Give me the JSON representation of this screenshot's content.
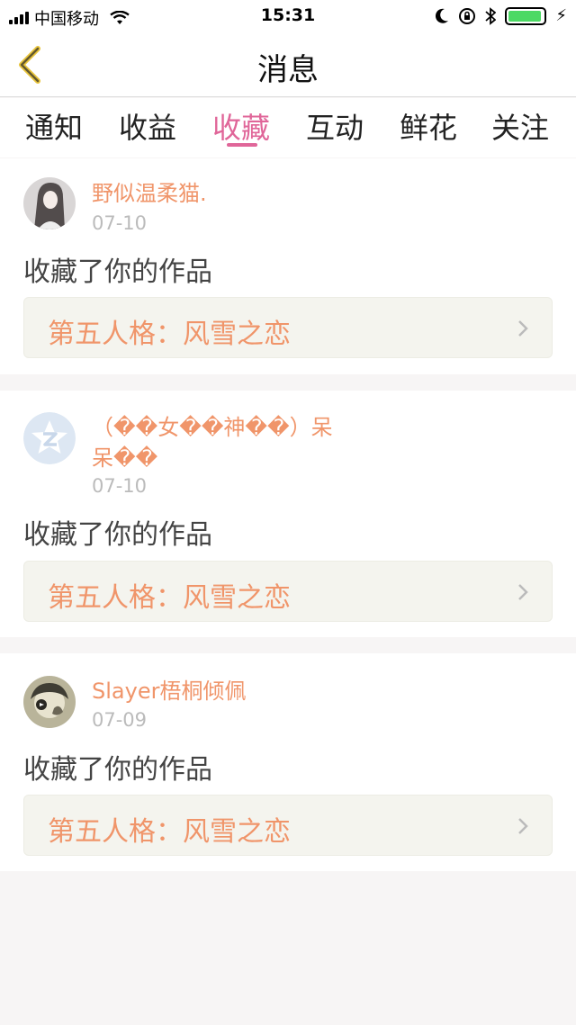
{
  "status_bar": {
    "carrier": "中国移动",
    "time": "15:31",
    "signal_bars": 4,
    "battery_level": 0.95,
    "icons": [
      "wifi-icon",
      "moon-icon",
      "rotation-lock-icon",
      "bluetooth-icon",
      "battery-icon",
      "charging-icon"
    ]
  },
  "header": {
    "title": "消息",
    "back_icon": "chevron-left-icon"
  },
  "tabs": [
    {
      "label": "通知",
      "active": false
    },
    {
      "label": "收益",
      "active": false
    },
    {
      "label": "收藏",
      "active": true
    },
    {
      "label": "互动",
      "active": false
    },
    {
      "label": "鲜花",
      "active": false
    },
    {
      "label": "关注",
      "active": false
    }
  ],
  "notifications": [
    {
      "username": "野似温柔猫.",
      "date": "07-10",
      "action": "收藏了你的作品",
      "work_title": "第五人格：风雪之恋"
    },
    {
      "username": "（��女��神��）呆呆��",
      "date": "07-10",
      "action": "收藏了你的作品",
      "work_title": "第五人格：风雪之恋"
    },
    {
      "username": "Slayer梧桐倾佩",
      "date": "07-09",
      "action": "收藏了你的作品",
      "work_title": "第五人格：风雪之恋"
    }
  ],
  "colors": {
    "accent": "#e06699",
    "username": "#f0956a",
    "battery": "#4cd964"
  }
}
